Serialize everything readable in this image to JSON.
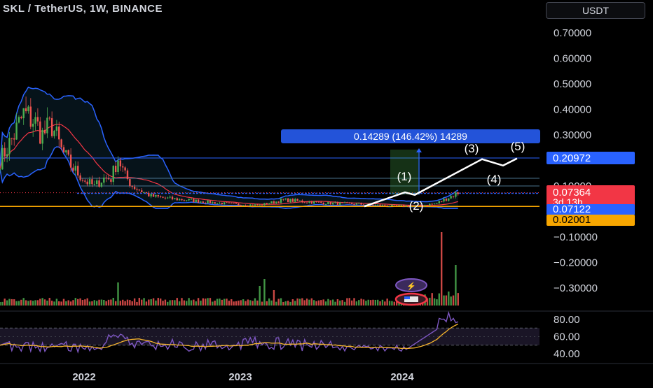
{
  "header": {
    "title": "SKL / TetherUS, 1W, BINANCE",
    "currency": "USDT"
  },
  "colors": {
    "up": "#26a69a",
    "up_candle": "#4caf50",
    "down": "#ef5350",
    "band": "#2962ff",
    "basis": "#f23645",
    "support": "#f7a600",
    "projection": "#ffffff",
    "rsi": "#7e57c2",
    "rsi_ma": "#f7b52c",
    "label_blue": "#2962ff",
    "label_red": "#f23645",
    "label_orange": "#f7a600"
  },
  "price_axis": {
    "ticks": [
      "0.70000",
      "0.60000",
      "0.50000",
      "0.40000",
      "0.30000",
      "0.10000",
      "−0.10000",
      "−0.20000",
      "−0.30000"
    ],
    "tick_values": [
      0.7,
      0.6,
      0.5,
      0.4,
      0.3,
      0.1,
      -0.1,
      -0.2,
      -0.3
    ]
  },
  "price_labels": {
    "target": "0.20972",
    "last": "0.07364",
    "countdown": "3d 13h",
    "band_value": "0.07122",
    "support": "0.02001"
  },
  "measure": {
    "label": "0.14289 (146.42%) 14289",
    "from": 0.066,
    "to": 0.20972
  },
  "waves": [
    "(1)",
    "(2)",
    "(3)",
    "(4)",
    "(5)"
  ],
  "rsi_axis": {
    "ticks": [
      "80.00",
      "60.00",
      "40.00"
    ],
    "tick_values": [
      80,
      60,
      40
    ]
  },
  "time_axis": {
    "labels": [
      "2022",
      "2023",
      "2024"
    ]
  },
  "chart_data": {
    "type": "candlestick",
    "title": "SKL / TetherUS, 1W, BINANCE",
    "x_labels": [
      "2022",
      "2023",
      "2024"
    ],
    "ylim": [
      -0.33,
      0.75
    ],
    "price_series_approx": [
      {
        "period": "late 2021",
        "close": 0.2
      },
      {
        "period": "Dec 2021",
        "close": 0.38
      },
      {
        "period": "early 2022",
        "close": 0.28
      },
      {
        "period": "Feb 2022",
        "close": 0.18
      },
      {
        "period": "Apr 2022",
        "close": 0.22
      },
      {
        "period": "May 2022",
        "close": 0.08
      },
      {
        "period": "mid 2022",
        "close": 0.05
      },
      {
        "period": "late 2022",
        "close": 0.025
      },
      {
        "period": "early 2023",
        "close": 0.045
      },
      {
        "period": "mid 2023",
        "close": 0.03
      },
      {
        "period": "late 2023",
        "close": 0.022
      },
      {
        "period": "early 2024",
        "close": 0.07364
      }
    ],
    "horizontal_levels": [
      0.20972,
      0.13,
      0.1,
      0.07122,
      0.02001
    ],
    "projection_path": [
      {
        "label": "(2)",
        "value": 0.03
      },
      {
        "label": "(1)",
        "value": 0.075
      },
      {
        "label": "(2)",
        "value": 0.06
      },
      {
        "label": "(3)",
        "value": 0.215
      },
      {
        "label": "(4)",
        "value": 0.17
      },
      {
        "label": "(5)",
        "value": 0.215
      }
    ],
    "rsi": {
      "ylim": [
        30,
        90
      ],
      "levels": [
        70,
        50
      ],
      "last": 80
    }
  }
}
